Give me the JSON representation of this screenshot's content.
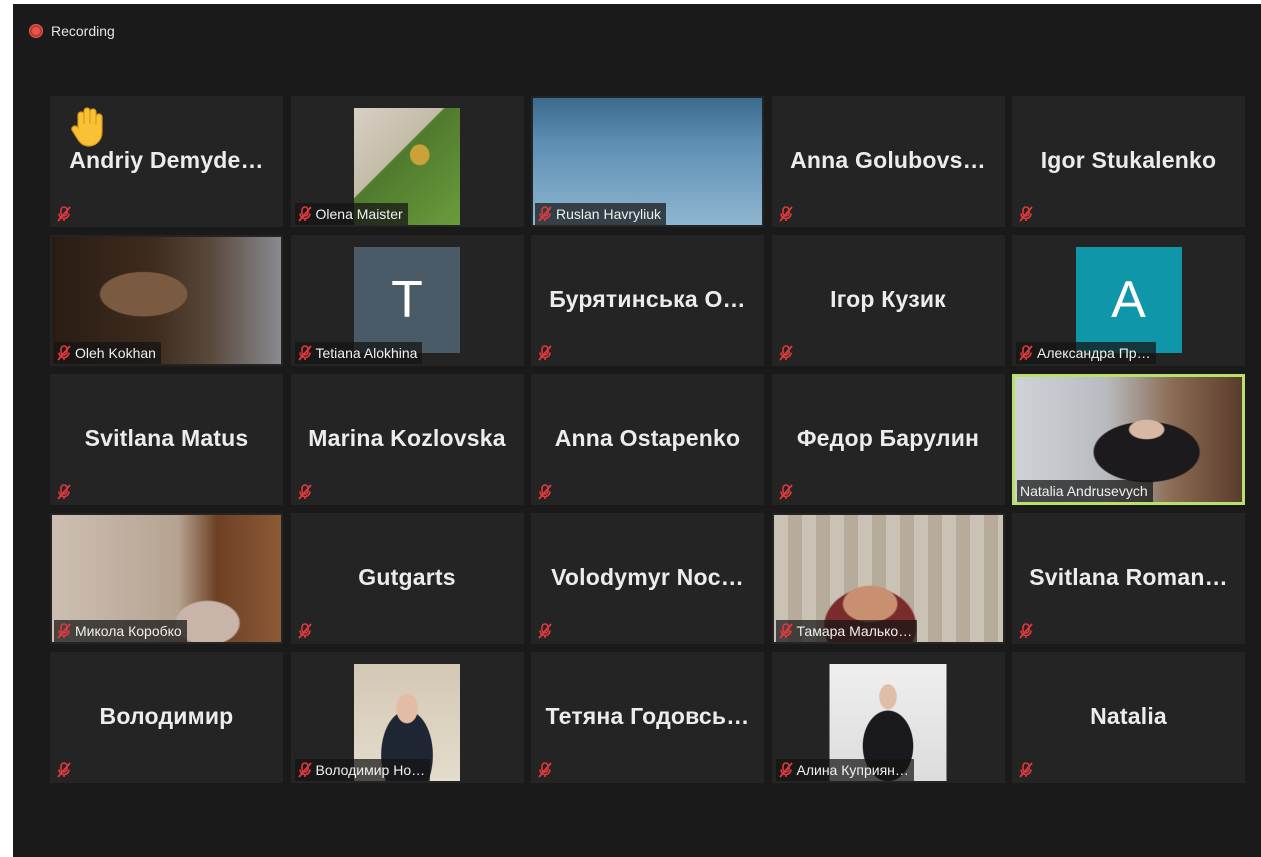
{
  "recording": {
    "label": "Recording"
  },
  "tiles": [
    {
      "name": "Andriy  Demyde…",
      "display": "name",
      "hand": true
    },
    {
      "label": "Olena Maister",
      "display": "photo",
      "photo": "garden-path"
    },
    {
      "label": "Ruslan Havryliuk",
      "display": "video",
      "video": "civil-society"
    },
    {
      "name": "Anna  Golubovs…",
      "display": "name"
    },
    {
      "name": "Igor Stukalenko",
      "display": "name"
    },
    {
      "label": "Oleh Kokhan",
      "display": "video",
      "video": "room-dark"
    },
    {
      "label": "Tetiana Alokhina",
      "display": "avatar",
      "letter": "T",
      "color": "#4a5a66"
    },
    {
      "name": "Бурятинська  О…",
      "display": "name"
    },
    {
      "name": "Ігор Кузик",
      "display": "name"
    },
    {
      "label": "Александра Пр…",
      "display": "avatar",
      "letter": "A",
      "color": "#0f96a8"
    },
    {
      "name": "Svitlana Matus",
      "display": "name"
    },
    {
      "name": "Marina Kozlovska",
      "display": "name"
    },
    {
      "name": "Anna Ostapenko",
      "display": "name"
    },
    {
      "name": "Федор Барулин",
      "display": "name"
    },
    {
      "label": "Natalia Andrusevych",
      "display": "video",
      "video": "bookshelf",
      "speaking": true
    },
    {
      "label": "Микола Коробко",
      "display": "video",
      "video": "wallpaper"
    },
    {
      "name": "Gutgarts",
      "display": "name"
    },
    {
      "name": "Volodymyr  Noc…",
      "display": "name"
    },
    {
      "label": "Тамара Малько…",
      "display": "video",
      "video": "rug"
    },
    {
      "name": "Svitlana  Roman…",
      "display": "name"
    },
    {
      "name": "Володимир",
      "display": "name"
    },
    {
      "label": "Володимир Но…",
      "display": "photo",
      "photo": "suit-desk"
    },
    {
      "name": "Тетяна  Годовсь…",
      "display": "name"
    },
    {
      "label": "Алина Куприян…",
      "display": "photo",
      "photo": "portrait-dark"
    },
    {
      "name": "Natalia",
      "display": "name"
    }
  ],
  "icons": {
    "mute": "microphone-muted-icon",
    "hand": "raised-hand-icon",
    "recording": "recording-dot-icon"
  },
  "colors": {
    "background": "#1a1a1a",
    "tile": "#242424",
    "speaking_border": "#b8e06a",
    "mute_red": "#e0393e"
  }
}
